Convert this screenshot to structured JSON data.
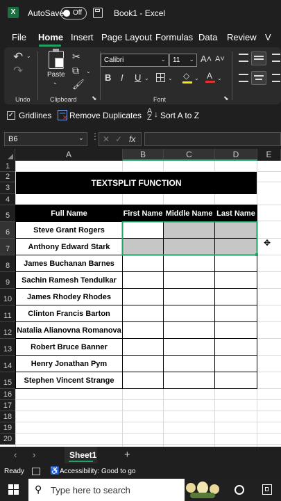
{
  "titlebar": {
    "app_icon": "excel-icon",
    "autosave_label": "AutoSave",
    "autosave_state": "Off",
    "save_icon": "save-icon",
    "title": "Book1 - Excel"
  },
  "menu": {
    "tabs": [
      "File",
      "Home",
      "Insert",
      "Page Layout",
      "Formulas",
      "Data",
      "Review",
      "V"
    ],
    "active": "Home"
  },
  "ribbon": {
    "undo_label": "Undo",
    "paste_label": "Paste",
    "clipboard_label": "Clipboard",
    "font_name": "Calibri",
    "font_size": "11",
    "bold": "B",
    "italic": "I",
    "underline": "U",
    "font_group_label": "Font"
  },
  "quickbar": {
    "gridlines_label": "Gridlines",
    "remove_duplicates_label": "Remove Duplicates",
    "sort_label": "Sort A to Z"
  },
  "formulabar": {
    "name_box": "B6",
    "fx": "fx",
    "formula": ""
  },
  "grid": {
    "columns": [
      "A",
      "B",
      "C",
      "D",
      "E"
    ],
    "rows": [
      "1",
      "2",
      "3",
      "4",
      "5",
      "6",
      "7",
      "8",
      "9",
      "10",
      "11",
      "12",
      "13",
      "14",
      "15",
      "16",
      "17",
      "18",
      "19",
      "20"
    ],
    "title": "TEXTSPLIT FUNCTION",
    "headers": [
      "Full Name",
      "First Name",
      "Middle Name",
      "Last Name"
    ],
    "names": [
      "Steve Grant Rogers",
      "Anthony Edward Stark",
      "James Buchanan Barnes",
      "Sachin Ramesh Tendulkar",
      "James Rhodey Rhodes",
      "Clinton Francis Barton",
      "Natalia Alianovna Romanova",
      "Robert Bruce Banner",
      "Henry Jonathan Pym",
      "Stephen Vincent Strange"
    ],
    "selected_cell": "B6",
    "selection_color": "#c6c6c6",
    "selection_border_color": "#21a366"
  },
  "sheettabs": {
    "tabs": [
      "Sheet1"
    ],
    "add_label": "+"
  },
  "statusbar": {
    "ready": "Ready",
    "accessibility": "Accessibility: Good to go"
  },
  "taskbar": {
    "search_placeholder": "Type here to search"
  }
}
